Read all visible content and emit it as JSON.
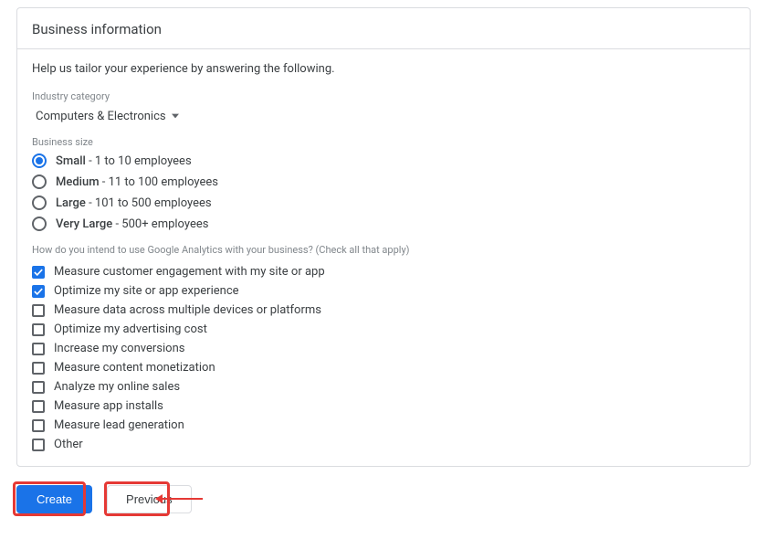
{
  "header": {
    "title": "Business information"
  },
  "intro": "Help us tailor your experience by answering the following.",
  "industry": {
    "label": "Industry category",
    "selected": "Computers & Electronics"
  },
  "business_size": {
    "label": "Business size",
    "options": [
      {
        "id": "small",
        "name": "Small",
        "desc": " - 1 to 10 employees",
        "selected": true
      },
      {
        "id": "medium",
        "name": "Medium",
        "desc": " - 11 to 100 employees",
        "selected": false
      },
      {
        "id": "large",
        "name": "Large",
        "desc": " - 101 to 500 employees",
        "selected": false
      },
      {
        "id": "xlarge",
        "name": "Very Large",
        "desc": " - 500+ employees",
        "selected": false
      }
    ]
  },
  "usage": {
    "question": "How do you intend to use Google Analytics with your business? (Check all that apply)",
    "options": [
      {
        "id": "engagement",
        "label": "Measure customer engagement with my site or app",
        "checked": true
      },
      {
        "id": "optimize",
        "label": "Optimize my site or app experience",
        "checked": true
      },
      {
        "id": "crossdevice",
        "label": "Measure data across multiple devices or platforms",
        "checked": false
      },
      {
        "id": "adcost",
        "label": "Optimize my advertising cost",
        "checked": false
      },
      {
        "id": "conversions",
        "label": "Increase my conversions",
        "checked": false
      },
      {
        "id": "monetization",
        "label": "Measure content monetization",
        "checked": false
      },
      {
        "id": "sales",
        "label": "Analyze my online sales",
        "checked": false
      },
      {
        "id": "installs",
        "label": "Measure app installs",
        "checked": false
      },
      {
        "id": "leads",
        "label": "Measure lead generation",
        "checked": false
      },
      {
        "id": "other",
        "label": "Other",
        "checked": false
      }
    ]
  },
  "footer": {
    "create": "Create",
    "previous": "Previous"
  }
}
